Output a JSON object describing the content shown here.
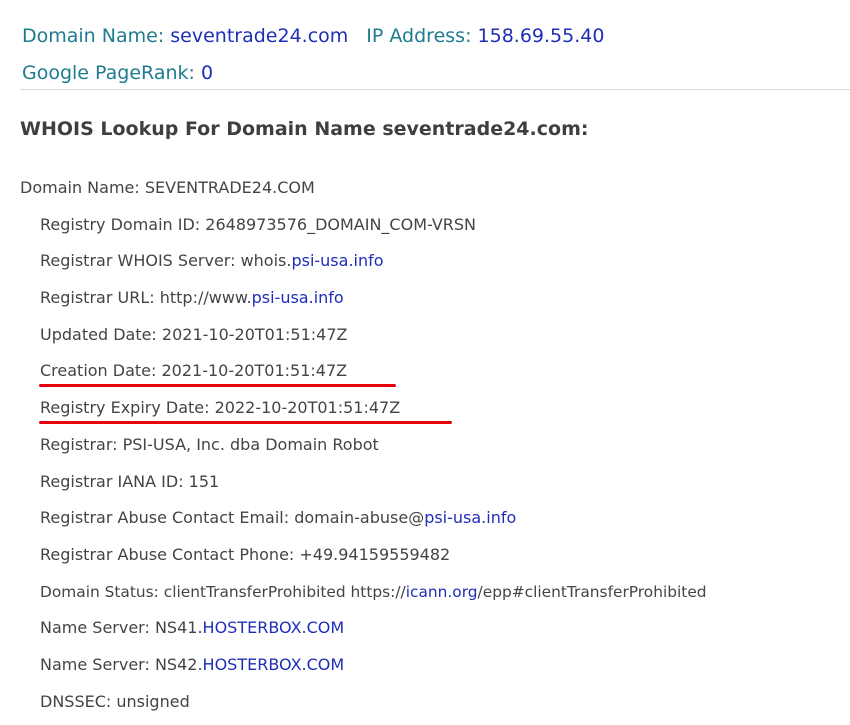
{
  "summary": {
    "domain_label": "Domain Name:",
    "domain_value": "seventrade24.com",
    "ip_label": "IP Address:",
    "ip_value": "158.69.55.40",
    "pagerank_label": "Google PageRank:",
    "pagerank_value": "0"
  },
  "heading": "WHOIS Lookup For Domain Name seventrade24.com:",
  "whois": {
    "domain_name": "Domain Name: SEVENTRADE24.COM",
    "registry_domain_id": "Registry Domain ID: 2648973576_DOMAIN_COM-VRSN",
    "whois_server_prefix": "Registrar WHOIS Server: whois.",
    "whois_server_link": "psi-usa.info",
    "registrar_url_prefix": "Registrar URL: http://www.",
    "registrar_url_link": "psi-usa.info",
    "updated_date": "Updated Date: 2021-10-20T01:51:47Z",
    "creation_date": "Creation Date: 2021-10-20T01:51:47Z",
    "expiry_date": "Registry Expiry Date: 2022-10-20T01:51:47Z",
    "registrar": "Registrar: PSI-USA, Inc. dba Domain Robot",
    "iana_id": "Registrar IANA ID: 151",
    "abuse_email_prefix": "Registrar Abuse Contact Email: domain-abuse@",
    "abuse_email_link": "psi-usa.info",
    "abuse_phone": "Registrar Abuse Contact Phone: +49.94159559482",
    "status_prefix": "Domain Status: clientTransferProhibited https://",
    "status_link": "icann.org",
    "status_suffix": "/epp#clientTransferProhibited",
    "ns1_prefix": "Name Server: NS41.",
    "ns1_link": "HOSTERBOX.COM",
    "ns2_prefix": "Name Server: NS42.",
    "ns2_link": "HOSTERBOX.COM",
    "dnssec": "DNSSEC: unsigned"
  },
  "colors": {
    "label": "#1f7b8f",
    "link": "#1f2eb7",
    "highlight_underline": "#e8000a"
  }
}
